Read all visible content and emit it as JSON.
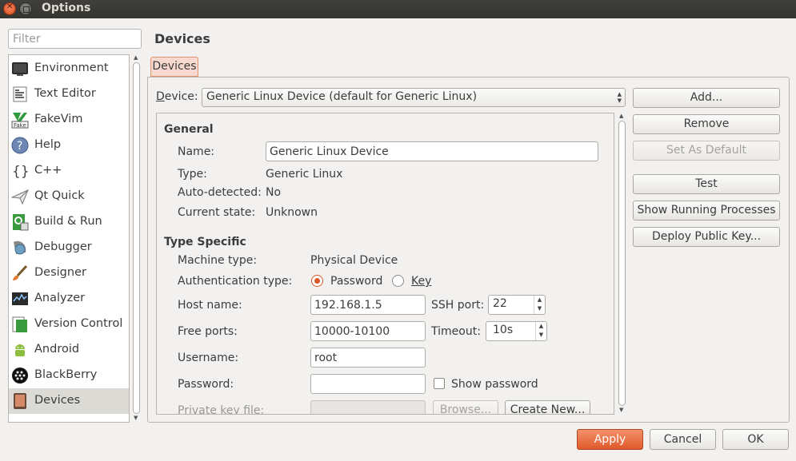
{
  "window": {
    "title": "Options"
  },
  "filter": {
    "placeholder": "Filter"
  },
  "sidebar": {
    "items": [
      {
        "label": "Environment",
        "icon": "monitor-icon"
      },
      {
        "label": "Text Editor",
        "icon": "text-document-icon"
      },
      {
        "label": "FakeVim",
        "icon": "fakevim-icon"
      },
      {
        "label": "Help",
        "icon": "help-icon"
      },
      {
        "label": "C++",
        "icon": "braces-icon"
      },
      {
        "label": "Qt Quick",
        "icon": "paper-plane-icon"
      },
      {
        "label": "Build & Run",
        "icon": "build-run-icon"
      },
      {
        "label": "Debugger",
        "icon": "bug-icon"
      },
      {
        "label": "Designer",
        "icon": "brush-icon"
      },
      {
        "label": "Analyzer",
        "icon": "analyzer-icon"
      },
      {
        "label": "Version Control",
        "icon": "version-control-icon"
      },
      {
        "label": "Android",
        "icon": "android-icon"
      },
      {
        "label": "BlackBerry",
        "icon": "blackberry-icon"
      },
      {
        "label": "Devices",
        "icon": "device-icon",
        "selected": true
      }
    ]
  },
  "page": {
    "title": "Devices",
    "tab": "Devices"
  },
  "device": {
    "label_prefix": "D",
    "label_rest": "evice:",
    "selected": "Generic Linux Device (default for Generic Linux)"
  },
  "buttons": {
    "add": "Add...",
    "remove": "Remove",
    "set_default": "Set As Default",
    "test": "Test",
    "show_processes": "Show Running Processes",
    "deploy_key": "Deploy Public Key..."
  },
  "general": {
    "heading": "General",
    "name_label": "Name:",
    "name_value": "Generic Linux Device",
    "type_label": "Type:",
    "type_value": "Generic Linux",
    "auto_label": "Auto-detected:",
    "auto_value": "No",
    "state_label": "Current state:",
    "state_value": "Unknown"
  },
  "type_specific": {
    "heading": "Type Specific",
    "machine_label": "Machine type:",
    "machine_value": "Physical Device",
    "auth_label": "Authentication type:",
    "auth_password": "Password",
    "auth_key": "Key",
    "host_label": "Host name:",
    "host_value": "192.168.1.5",
    "ssh_label": "SSH port:",
    "ssh_value": "22",
    "free_label": "Free ports:",
    "free_value": "10000-10100",
    "timeout_label": "Timeout:",
    "timeout_value": "10s",
    "user_label": "Username:",
    "user_value": "root",
    "pass_label": "Password:",
    "pass_value": "",
    "show_password": "Show password",
    "key_file_label": "Private key file:",
    "browse": "Browse...",
    "create_new": "Create New..."
  },
  "footer": {
    "apply": "Apply",
    "cancel": "Cancel",
    "ok": "OK"
  },
  "colors": {
    "accent": "#df5a2c",
    "titlebar": "#3c3b37",
    "selection": "#dcdad5"
  }
}
